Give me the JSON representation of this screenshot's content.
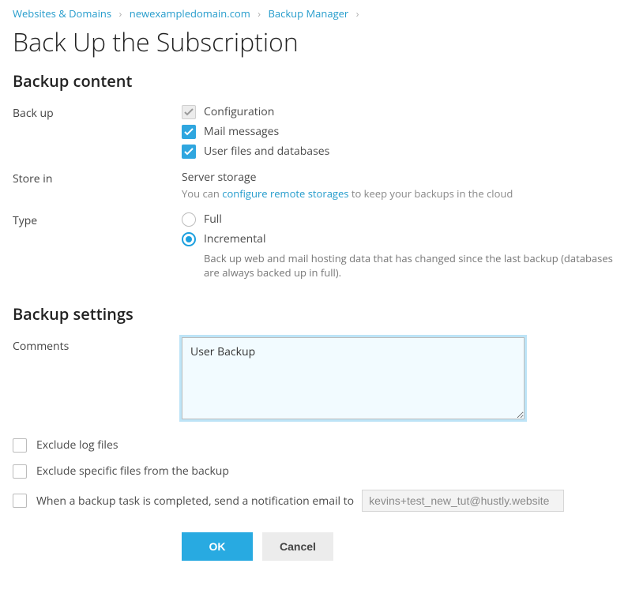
{
  "breadcrumb": {
    "items": [
      "Websites & Domains",
      "newexampledomain.com",
      "Backup Manager"
    ]
  },
  "page_title": "Back Up the Subscription",
  "sections": {
    "content": {
      "heading": "Backup content",
      "backup_label": "Back up",
      "backup_options": {
        "configuration": "Configuration",
        "mail": "Mail messages",
        "files": "User files and databases"
      },
      "store_label": "Store in",
      "store_value": "Server storage",
      "store_hint_pre": "You can ",
      "store_hint_link": "configure remote storages",
      "store_hint_post": " to keep your backups in the cloud",
      "type_label": "Type",
      "type_options": {
        "full": "Full",
        "incremental": "Incremental"
      },
      "incremental_hint": "Back up web and mail hosting data that has changed since the last backup (databases are always backed up in full)."
    },
    "settings": {
      "heading": "Backup settings",
      "comments_label": "Comments",
      "comments_value": "User Backup",
      "exclude_log": "Exclude log files",
      "exclude_files": "Exclude specific files from the backup",
      "notify_label": "When a backup task is completed, send a notification email to",
      "notify_email": "kevins+test_new_tut@hustly.website"
    }
  },
  "actions": {
    "ok": "OK",
    "cancel": "Cancel"
  }
}
